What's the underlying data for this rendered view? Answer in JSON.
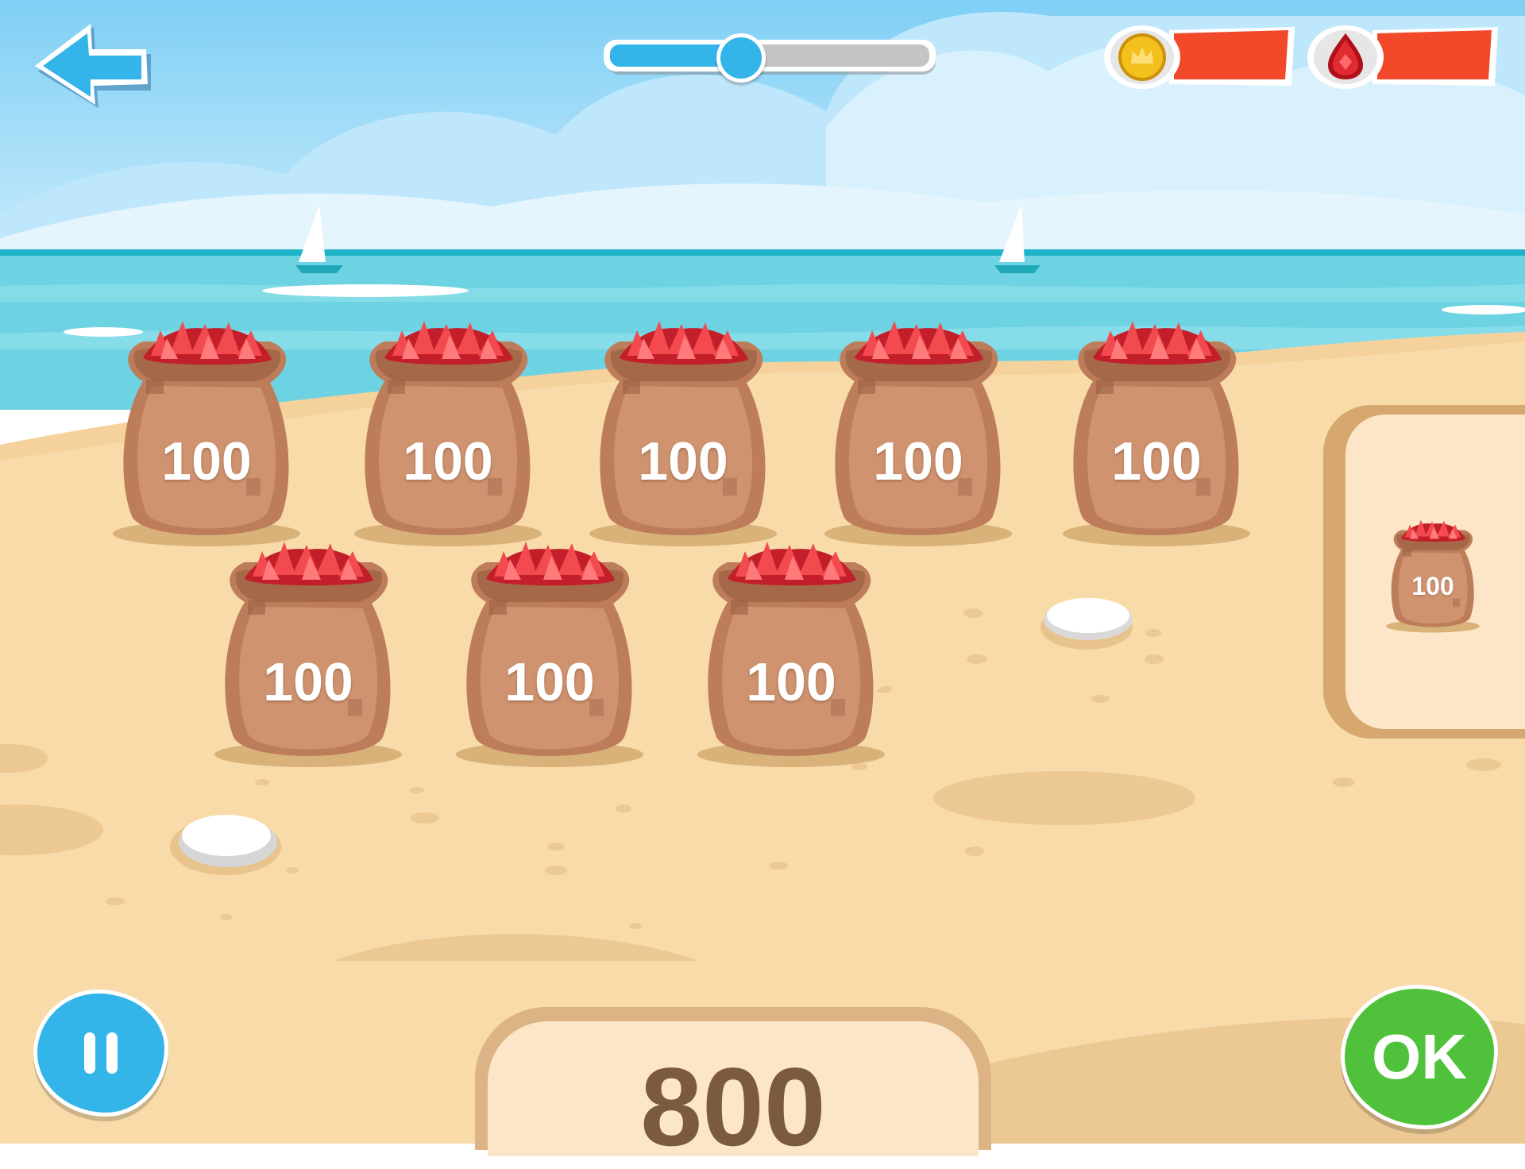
{
  "header": {
    "back_button": {
      "icon": "arrow-left-icon"
    },
    "progress": {
      "value": 0.41
    },
    "resources": [
      {
        "icon": "crown-coin-icon",
        "bar_color": "#f2492b"
      },
      {
        "icon": "ruby-gem-icon",
        "bar_color": "#f2492b"
      }
    ]
  },
  "play_area": {
    "sacks": [
      {
        "label": "100"
      },
      {
        "label": "100"
      },
      {
        "label": "100"
      },
      {
        "label": "100"
      },
      {
        "label": "100"
      },
      {
        "label": "100"
      },
      {
        "label": "100"
      },
      {
        "label": "100"
      }
    ]
  },
  "tray": {
    "sack": {
      "label": "100"
    }
  },
  "footer": {
    "pause_button": {
      "icon": "pause-icon"
    },
    "total": "800",
    "ok_button": {
      "label": "OK"
    }
  },
  "colors": {
    "accent_blue": "#33b5ea",
    "ok_green": "#4fc13a",
    "resource_bar": "#f2492b",
    "sand": "#f8dba9",
    "sea": "#6dd3e2"
  }
}
